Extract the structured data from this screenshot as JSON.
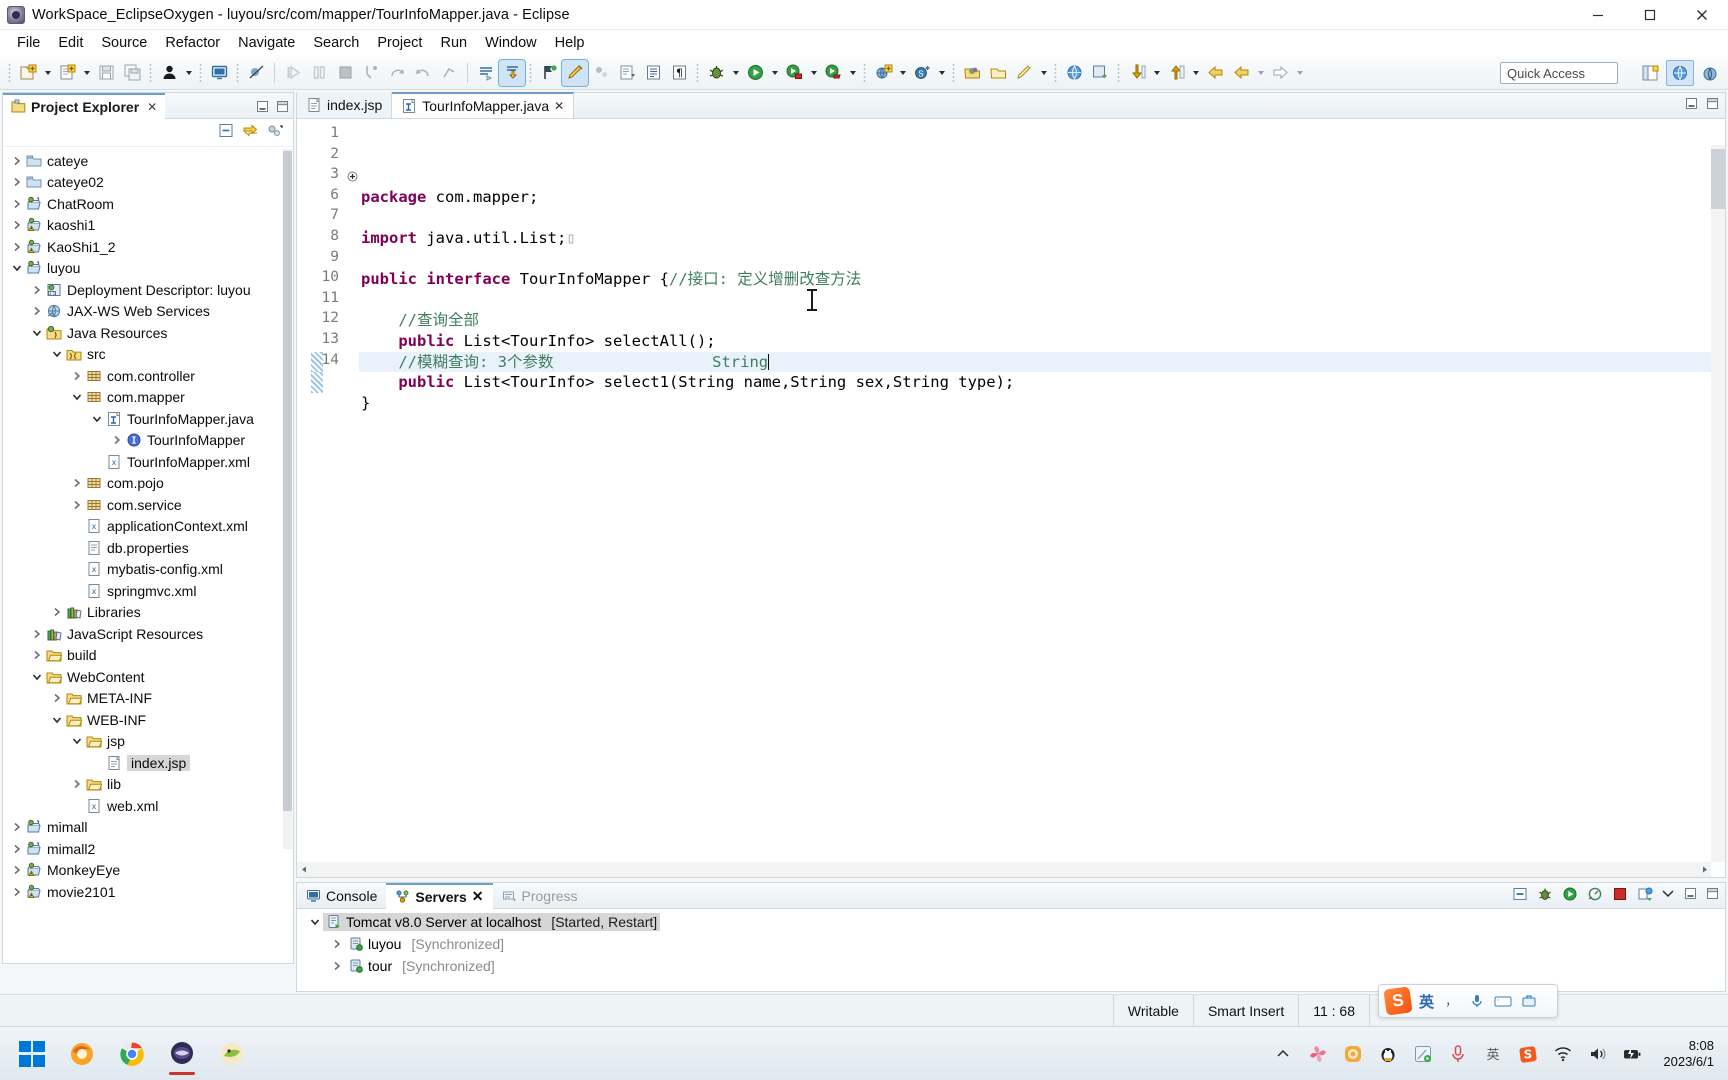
{
  "window": {
    "title": "WorkSpace_EclipseOxygen - luyou/src/com/mapper/TourInfoMapper.java - Eclipse",
    "icon": "eclipse-icon",
    "minimize": "minimize-button",
    "maximize": "maximize-button",
    "close": "close-button"
  },
  "menubar": {
    "items": [
      {
        "label": "File"
      },
      {
        "label": "Edit"
      },
      {
        "label": "Source"
      },
      {
        "label": "Refactor"
      },
      {
        "label": "Navigate"
      },
      {
        "label": "Search"
      },
      {
        "label": "Project"
      },
      {
        "label": "Run"
      },
      {
        "label": "Window"
      },
      {
        "label": "Help"
      }
    ]
  },
  "toolbar": {
    "quick_access_placeholder": "Quick Access"
  },
  "explorer": {
    "tab_label": "Project Explorer",
    "close_glyph": "✕",
    "tree": [
      {
        "indent": 0,
        "twist": "collapsed",
        "icon": "folder-closed-icon",
        "label": "cateye"
      },
      {
        "indent": 0,
        "twist": "collapsed",
        "icon": "folder-closed-icon",
        "label": "cateye02"
      },
      {
        "indent": 0,
        "twist": "collapsed",
        "icon": "web-project-icon",
        "label": "ChatRoom"
      },
      {
        "indent": 0,
        "twist": "collapsed",
        "icon": "web-project-warn-icon",
        "label": "kaoshi1"
      },
      {
        "indent": 0,
        "twist": "collapsed",
        "icon": "web-project-warn-icon",
        "label": "KaoShi1_2"
      },
      {
        "indent": 0,
        "twist": "expanded",
        "icon": "web-project-icon",
        "label": "luyou"
      },
      {
        "indent": 1,
        "twist": "collapsed",
        "icon": "deployment-descriptor-icon",
        "label": "Deployment Descriptor: luyou"
      },
      {
        "indent": 1,
        "twist": "collapsed",
        "icon": "jaxws-icon",
        "label": "JAX-WS Web Services"
      },
      {
        "indent": 1,
        "twist": "expanded",
        "icon": "java-resources-icon",
        "label": "Java Resources"
      },
      {
        "indent": 2,
        "twist": "expanded",
        "icon": "source-folder-icon",
        "label": "src"
      },
      {
        "indent": 3,
        "twist": "collapsed",
        "icon": "package-icon",
        "label": "com.controller"
      },
      {
        "indent": 3,
        "twist": "expanded",
        "icon": "package-icon",
        "label": "com.mapper"
      },
      {
        "indent": 4,
        "twist": "expanded",
        "icon": "java-interface-file-icon",
        "label": "TourInfoMapper.java"
      },
      {
        "indent": 5,
        "twist": "collapsed",
        "icon": "interface-icon",
        "label": "TourInfoMapper"
      },
      {
        "indent": 4,
        "twist": "none",
        "icon": "xml-file-icon",
        "label": "TourInfoMapper.xml"
      },
      {
        "indent": 3,
        "twist": "collapsed",
        "icon": "package-icon",
        "label": "com.pojo"
      },
      {
        "indent": 3,
        "twist": "collapsed",
        "icon": "package-icon",
        "label": "com.service"
      },
      {
        "indent": 3,
        "twist": "none",
        "icon": "xml-file-icon",
        "label": "applicationContext.xml"
      },
      {
        "indent": 3,
        "twist": "none",
        "icon": "properties-file-icon",
        "label": "db.properties"
      },
      {
        "indent": 3,
        "twist": "none",
        "icon": "xml-file-icon",
        "label": "mybatis-config.xml"
      },
      {
        "indent": 3,
        "twist": "none",
        "icon": "xml-file-icon",
        "label": "springmvc.xml"
      },
      {
        "indent": 2,
        "twist": "collapsed",
        "icon": "libraries-icon",
        "label": "Libraries"
      },
      {
        "indent": 1,
        "twist": "collapsed",
        "icon": "libraries-icon",
        "label": "JavaScript Resources"
      },
      {
        "indent": 1,
        "twist": "collapsed",
        "icon": "folder-open-icon",
        "label": "build"
      },
      {
        "indent": 1,
        "twist": "expanded",
        "icon": "folder-open-icon",
        "label": "WebContent"
      },
      {
        "indent": 2,
        "twist": "collapsed",
        "icon": "folder-open-icon",
        "label": "META-INF"
      },
      {
        "indent": 2,
        "twist": "expanded",
        "icon": "folder-open-icon",
        "label": "WEB-INF"
      },
      {
        "indent": 3,
        "twist": "expanded",
        "icon": "folder-open-icon",
        "label": "jsp"
      },
      {
        "indent": 4,
        "twist": "none",
        "icon": "jsp-file-icon",
        "label": "index.jsp",
        "selected": true
      },
      {
        "indent": 3,
        "twist": "collapsed",
        "icon": "folder-open-icon",
        "label": "lib"
      },
      {
        "indent": 3,
        "twist": "none",
        "icon": "xml-file-icon",
        "label": "web.xml"
      },
      {
        "indent": 0,
        "twist": "collapsed",
        "icon": "web-project-icon",
        "label": "mimall"
      },
      {
        "indent": 0,
        "twist": "collapsed",
        "icon": "web-project-icon",
        "label": "mimall2"
      },
      {
        "indent": 0,
        "twist": "collapsed",
        "icon": "web-project-warn-icon",
        "label": "MonkeyEye"
      },
      {
        "indent": 0,
        "twist": "collapsed",
        "icon": "web-project-warn-icon",
        "label": "movie2101"
      }
    ]
  },
  "editor": {
    "tabs": [
      {
        "label": "index.jsp",
        "icon": "jsp-file-icon",
        "active": false
      },
      {
        "label": "TourInfoMapper.java",
        "icon": "java-interface-file-icon",
        "active": true,
        "close_glyph": "✕"
      }
    ],
    "gutter": [
      "1",
      "2",
      "3",
      "6",
      "7",
      "8",
      "9",
      "10",
      "11",
      "12",
      "13",
      "14"
    ],
    "code_lines": [
      {
        "num": "1",
        "segments": [
          {
            "t": "package",
            "c": "kw"
          },
          {
            "t": " com.mapper;",
            "c": ""
          }
        ]
      },
      {
        "num": "2",
        "segments": []
      },
      {
        "num": "3",
        "fold": true,
        "segments": [
          {
            "t": "import",
            "c": "kw"
          },
          {
            "t": " java.util.List;",
            "c": ""
          },
          {
            "t": "▯",
            "c": "fold-placeholder"
          }
        ]
      },
      {
        "num": "6",
        "segments": []
      },
      {
        "num": "7",
        "segments": [
          {
            "t": "public",
            "c": "kw"
          },
          {
            "t": " ",
            "c": ""
          },
          {
            "t": "interface",
            "c": "kw"
          },
          {
            "t": " TourInfoMapper {",
            "c": ""
          },
          {
            "t": "//接口: 定义增删改查方法",
            "c": "cmt"
          }
        ]
      },
      {
        "num": "8",
        "segments": []
      },
      {
        "num": "9",
        "segments": [
          {
            "t": "    ",
            "c": ""
          },
          {
            "t": "//查询全部",
            "c": "cmt"
          }
        ]
      },
      {
        "num": "10",
        "segments": [
          {
            "t": "    ",
            "c": ""
          },
          {
            "t": "public",
            "c": "kw"
          },
          {
            "t": " List<TourInfo> selectAll();",
            "c": ""
          }
        ]
      },
      {
        "num": "11",
        "highlight": true,
        "marked": true,
        "segments": [
          {
            "t": "    ",
            "c": ""
          },
          {
            "t": "//模糊查询: 3个参数                 String",
            "c": "cmt"
          }
        ],
        "caret": true
      },
      {
        "num": "12",
        "marked": true,
        "segments": [
          {
            "t": "    ",
            "c": ""
          },
          {
            "t": "public",
            "c": "kw"
          },
          {
            "t": " List<TourInfo> select1(String name,String sex,String type);",
            "c": ""
          }
        ]
      },
      {
        "num": "13",
        "segments": [
          {
            "t": "}",
            "c": ""
          }
        ]
      },
      {
        "num": "14",
        "segments": []
      }
    ]
  },
  "bottom_panel": {
    "tabs": [
      {
        "label": "Console",
        "icon": "console-icon",
        "active": false
      },
      {
        "label": "Servers",
        "icon": "servers-icon",
        "active": true,
        "close_glyph": "✕"
      },
      {
        "label": "Progress",
        "icon": "progress-icon",
        "active": false,
        "dim": true
      }
    ],
    "rows": [
      {
        "indent": 0,
        "twist": "expanded",
        "icon": "server-icon",
        "label": "Tomcat v8.0 Server at localhost",
        "status": "[Started, Restart]",
        "selected": true
      },
      {
        "indent": 1,
        "twist": "collapsed",
        "icon": "module-icon",
        "label": "luyou",
        "status": "[Synchronized]"
      },
      {
        "indent": 1,
        "twist": "collapsed",
        "icon": "module-icon",
        "label": "tour",
        "status": "[Synchronized]"
      }
    ]
  },
  "statusbar": {
    "writable": "Writable",
    "insert_mode": "Smart Insert",
    "position": "11 : 68"
  },
  "ime": {
    "label": "英",
    "logo_letter": "S"
  },
  "taskbar": {
    "clock_time": "8:08",
    "clock_date": "2023/6/1"
  },
  "colors": {
    "keyword": "#7f0055",
    "comment": "#3f7f5f",
    "selection": "#d6d6d6",
    "line_highlight": "#e9f2fb",
    "tab_accent": "#6d9fca"
  }
}
